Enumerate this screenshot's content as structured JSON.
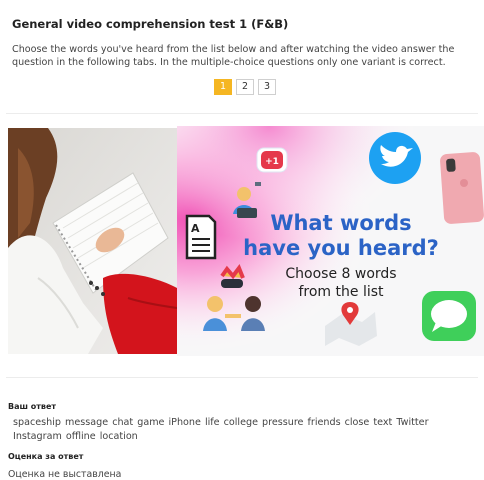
{
  "quiz": {
    "title": "General video comprehension test 1 (F&B)",
    "instructions": "Choose the words you've heard from the list below and after watching the video answer the question in the following tabs. In the multiple-choice questions only one variant is correct.",
    "pages": [
      "1",
      "2",
      "3"
    ],
    "active_page": "1"
  },
  "banner": {
    "heading_line1": "What words",
    "heading_line2": "have you heard?",
    "subheading_line1": "Choose 8 words",
    "subheading_line2": "from the list",
    "badge": "+1",
    "accent_blue": "#2b63c6",
    "icons": [
      "chat-plus-one-icon",
      "person-laptop-icon",
      "document-icon",
      "twitter-icon",
      "phone-icon",
      "gamers-icon",
      "map-pin-icon",
      "message-bubble-icon"
    ]
  },
  "answer": {
    "label": "Ваш ответ",
    "text": "spaceship message chat game iPhone life college pressure friends close text Twitter Instagram offline location"
  },
  "grade": {
    "label": "Оценка за ответ",
    "value": "Оценка не выставлена"
  },
  "colors": {
    "accent": "#f5b622"
  }
}
